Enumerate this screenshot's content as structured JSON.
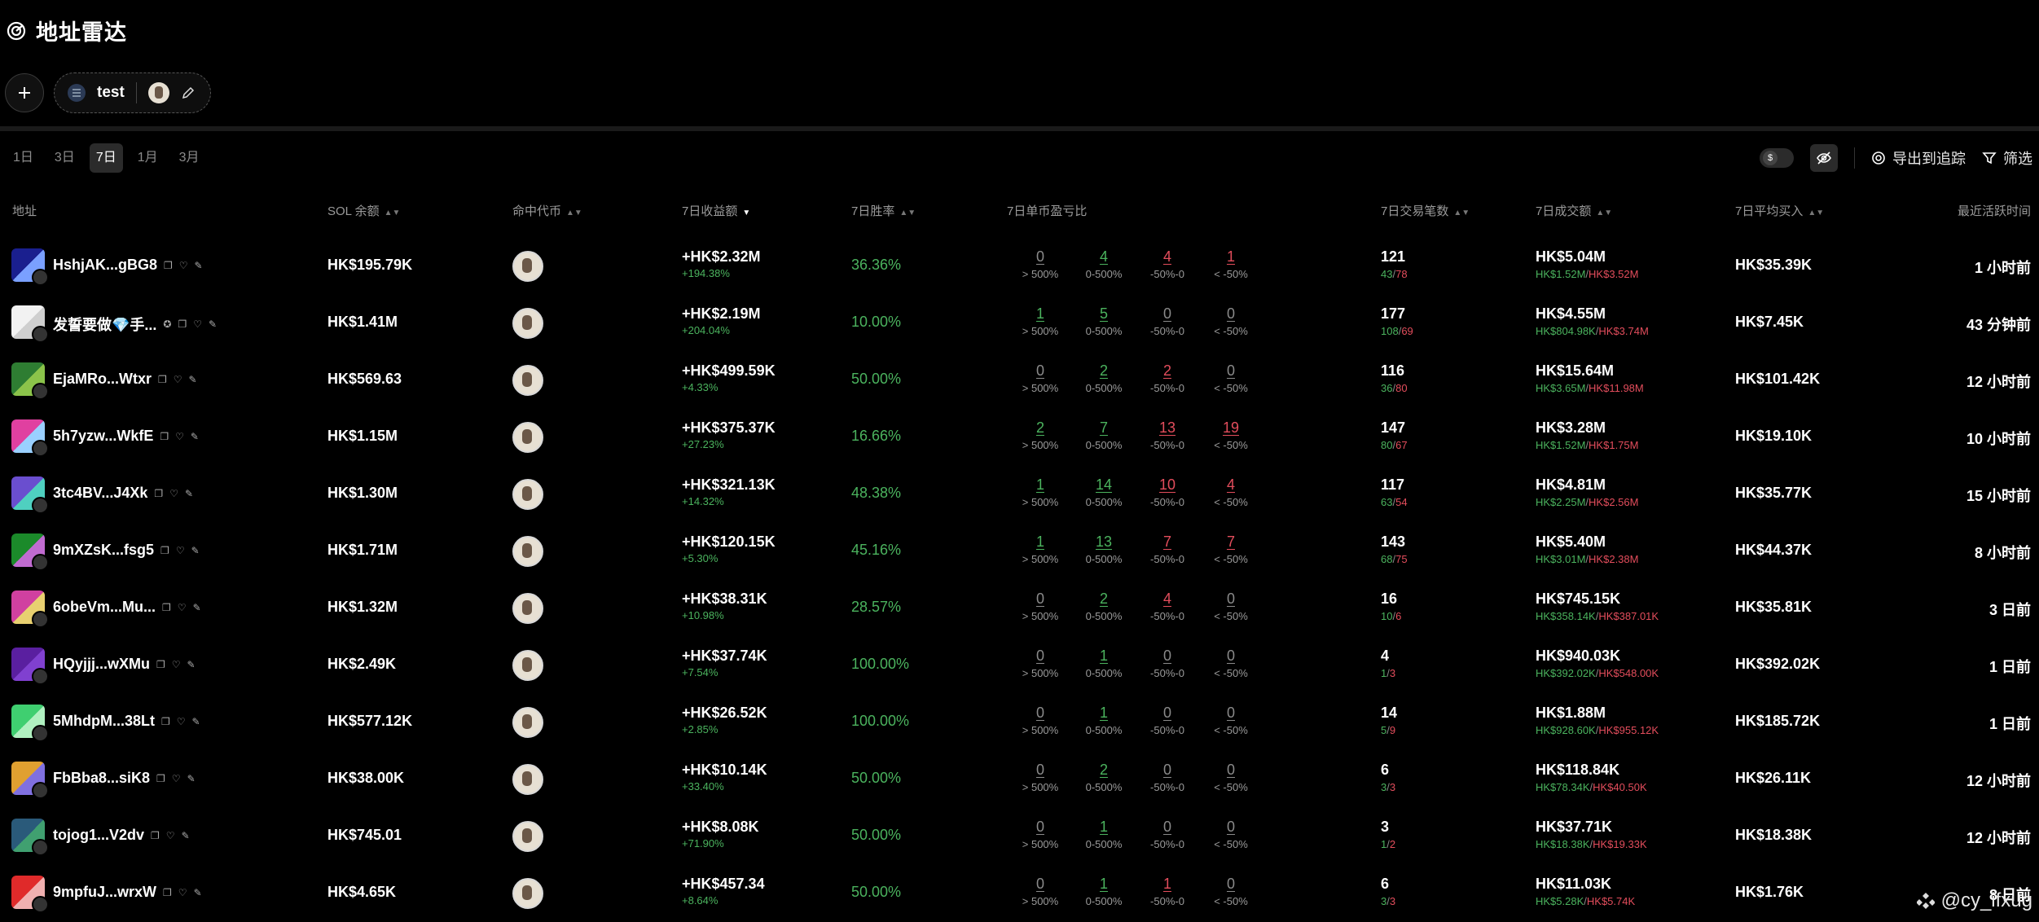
{
  "header": {
    "title": "地址雷达",
    "group_name": "test"
  },
  "tabs": [
    {
      "label": "1日",
      "active": false
    },
    {
      "label": "3日",
      "active": false
    },
    {
      "label": "7日",
      "active": true
    },
    {
      "label": "1月",
      "active": false
    },
    {
      "label": "3月",
      "active": false
    }
  ],
  "tools": {
    "currency_symbol": "$",
    "export_label": "导出到追踪",
    "filter_label": "筛选"
  },
  "columns": {
    "address": "地址",
    "sol_balance": "SOL 余额",
    "hit_token": "命中代币",
    "profit": "7日收益额",
    "win_rate": "7日胜率",
    "pnl_ratio": "7日单币盈亏比",
    "trades": "7日交易笔数",
    "volume": "7日成交额",
    "avg_buy": "7日平均买入",
    "last_active": "最近活跃时间"
  },
  "dist_labels": [
    "> 500%",
    "0-500%",
    "-50%-0",
    "< -50%"
  ],
  "rows": [
    {
      "address": "HshjAK...gBG8",
      "balance": "HK$195.79K",
      "profit": "+HK$2.32M",
      "profit_pct": "+194.38%",
      "win": "36.36%",
      "dist": [
        "0",
        "4",
        "4",
        "1"
      ],
      "trades": "121",
      "buys": "43",
      "sells": "78",
      "volume": "HK$5.04M",
      "vol_buy": "HK$1.52M",
      "vol_sell": "HK$3.52M",
      "avg": "HK$35.39K",
      "last": "1 小时前",
      "c1": "#1a1f8f",
      "c2": "#7aa0ff"
    },
    {
      "address": "发誓要做💎手...",
      "sub_badge": "✪",
      "balance": "HK$1.41M",
      "profit": "+HK$2.19M",
      "profit_pct": "+204.04%",
      "win": "10.00%",
      "dist": [
        "1",
        "5",
        "0",
        "0"
      ],
      "trades": "177",
      "buys": "108",
      "sells": "69",
      "volume": "HK$4.55M",
      "vol_buy": "HK$804.98K",
      "vol_sell": "HK$3.74M",
      "avg": "HK$7.45K",
      "last": "43 分钟前",
      "c1": "#f2f2f2",
      "c2": "#cfcfcf"
    },
    {
      "address": "EjaMRo...Wtxr",
      "balance": "HK$569.63",
      "profit": "+HK$499.59K",
      "profit_pct": "+4.33%",
      "win": "50.00%",
      "dist": [
        "0",
        "2",
        "2",
        "0"
      ],
      "trades": "116",
      "buys": "36",
      "sells": "80",
      "volume": "HK$15.64M",
      "vol_buy": "HK$3.65M",
      "vol_sell": "HK$11.98M",
      "avg": "HK$101.42K",
      "last": "12 小时前",
      "c1": "#2e7d32",
      "c2": "#8bc34a"
    },
    {
      "address": "5h7yzw...WkfE",
      "balance": "HK$1.15M",
      "profit": "+HK$375.37K",
      "profit_pct": "+27.23%",
      "win": "16.66%",
      "dist": [
        "2",
        "7",
        "13",
        "19"
      ],
      "trades": "147",
      "buys": "80",
      "sells": "67",
      "volume": "HK$3.28M",
      "vol_buy": "HK$1.52M",
      "vol_sell": "HK$1.75M",
      "avg": "HK$19.10K",
      "last": "10 小时前",
      "c1": "#e040a0",
      "c2": "#9ad0ff"
    },
    {
      "address": "3tc4BV...J4Xk",
      "balance": "HK$1.30M",
      "profit": "+HK$321.13K",
      "profit_pct": "+14.32%",
      "win": "48.38%",
      "dist": [
        "1",
        "14",
        "10",
        "4"
      ],
      "trades": "117",
      "buys": "63",
      "sells": "54",
      "volume": "HK$4.81M",
      "vol_buy": "HK$2.25M",
      "vol_sell": "HK$2.56M",
      "avg": "HK$35.77K",
      "last": "15 小时前",
      "c1": "#6a4ecf",
      "c2": "#4fd0c0"
    },
    {
      "address": "9mXZsK...fsg5",
      "balance": "HK$1.71M",
      "profit": "+HK$120.15K",
      "profit_pct": "+5.30%",
      "win": "45.16%",
      "dist": [
        "1",
        "13",
        "7",
        "7"
      ],
      "trades": "143",
      "buys": "68",
      "sells": "75",
      "volume": "HK$5.40M",
      "vol_buy": "HK$3.01M",
      "vol_sell": "HK$2.38M",
      "avg": "HK$44.37K",
      "last": "8 小时前",
      "c1": "#1b8a2a",
      "c2": "#c06bd0"
    },
    {
      "address": "6obeVm...Mu...",
      "balance": "HK$1.32M",
      "profit": "+HK$38.31K",
      "profit_pct": "+10.98%",
      "win": "28.57%",
      "dist": [
        "0",
        "2",
        "4",
        "0"
      ],
      "trades": "16",
      "buys": "10",
      "sells": "6",
      "volume": "HK$745.15K",
      "vol_buy": "HK$358.14K",
      "vol_sell": "HK$387.01K",
      "avg": "HK$35.81K",
      "last": "3 日前",
      "c1": "#d040a0",
      "c2": "#e8d070"
    },
    {
      "address": "HQyjjj...wXMu",
      "balance": "HK$2.49K",
      "profit": "+HK$37.74K",
      "profit_pct": "+7.54%",
      "win": "100.00%",
      "dist": [
        "0",
        "1",
        "0",
        "0"
      ],
      "trades": "4",
      "buys": "1",
      "sells": "3",
      "volume": "HK$940.03K",
      "vol_buy": "HK$392.02K",
      "vol_sell": "HK$548.00K",
      "avg": "HK$392.02K",
      "last": "1 日前",
      "c1": "#5a1fa0",
      "c2": "#8040d0"
    },
    {
      "address": "5MhdpM...38Lt",
      "balance": "HK$577.12K",
      "profit": "+HK$26.52K",
      "profit_pct": "+2.85%",
      "win": "100.00%",
      "dist": [
        "0",
        "1",
        "0",
        "0"
      ],
      "trades": "14",
      "buys": "5",
      "sells": "9",
      "volume": "HK$1.88M",
      "vol_buy": "HK$928.60K",
      "vol_sell": "HK$955.12K",
      "avg": "HK$185.72K",
      "last": "1 日前",
      "c1": "#3fcf70",
      "c2": "#b0f0c0"
    },
    {
      "address": "FbBba8...siK8",
      "balance": "HK$38.00K",
      "profit": "+HK$10.14K",
      "profit_pct": "+33.40%",
      "win": "50.00%",
      "dist": [
        "0",
        "2",
        "0",
        "0"
      ],
      "trades": "6",
      "buys": "3",
      "sells": "3",
      "volume": "HK$118.84K",
      "vol_buy": "HK$78.34K",
      "vol_sell": "HK$40.50K",
      "avg": "HK$26.11K",
      "last": "12 小时前",
      "c1": "#e0a030",
      "c2": "#8070e0"
    },
    {
      "address": "tojog1...V2dv",
      "balance": "HK$745.01",
      "profit": "+HK$8.08K",
      "profit_pct": "+71.90%",
      "win": "50.00%",
      "dist": [
        "0",
        "1",
        "0",
        "0"
      ],
      "trades": "3",
      "buys": "1",
      "sells": "2",
      "volume": "HK$37.71K",
      "vol_buy": "HK$18.38K",
      "vol_sell": "HK$19.33K",
      "avg": "HK$18.38K",
      "last": "12 小时前",
      "c1": "#2a5a7a",
      "c2": "#40a070"
    },
    {
      "address": "9mpfuJ...wrxW",
      "balance": "HK$4.65K",
      "profit": "+HK$457.34",
      "profit_pct": "+8.64%",
      "win": "50.00%",
      "dist": [
        "0",
        "1",
        "1",
        "0"
      ],
      "trades": "6",
      "buys": "3",
      "sells": "3",
      "volume": "HK$11.03K",
      "vol_buy": "HK$5.28K",
      "vol_sell": "HK$5.74K",
      "avg": "HK$1.76K",
      "last": "8 日前",
      "c1": "#e02a2a",
      "c2": "#f0b0b0"
    }
  ],
  "watermark": "@cy_ifxug"
}
